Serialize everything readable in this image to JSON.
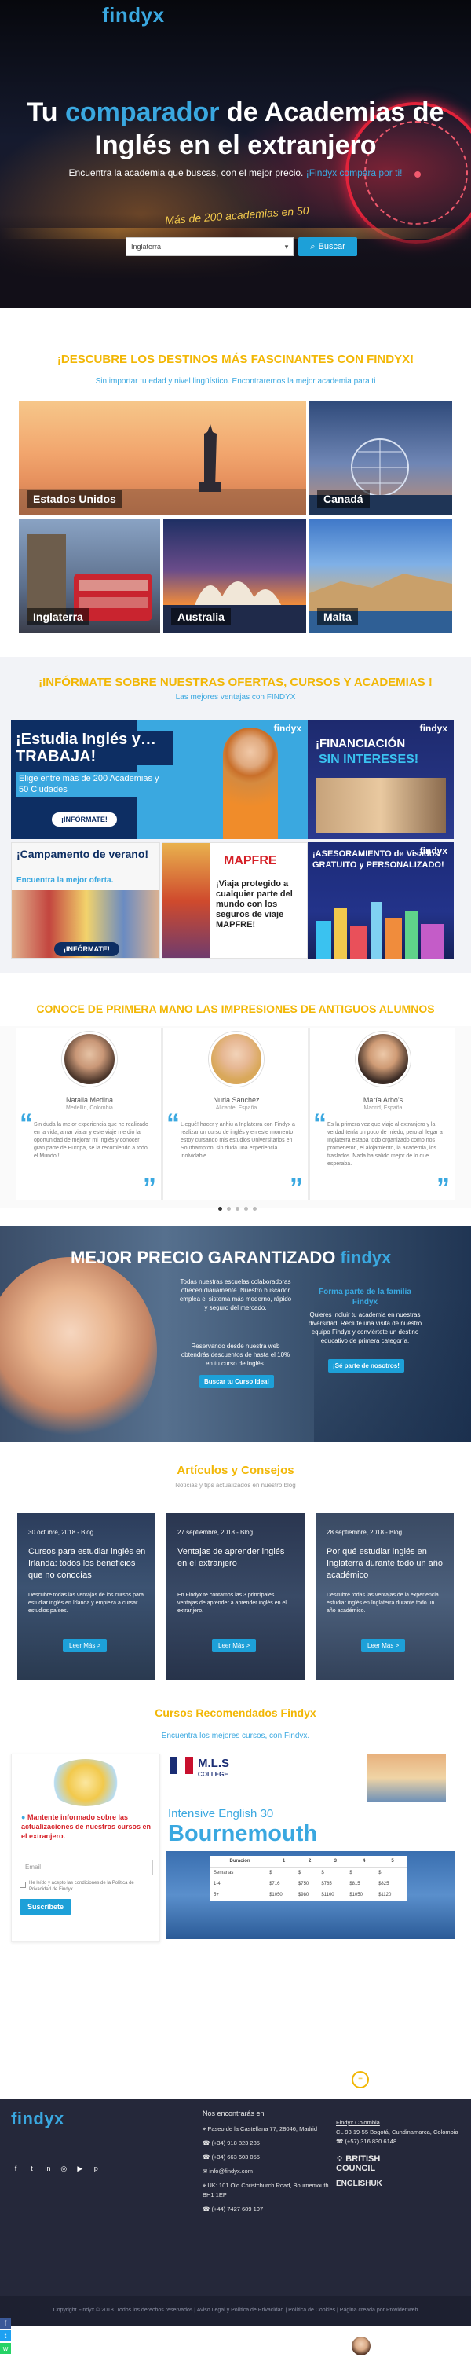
{
  "header": {
    "logo": "findyx"
  },
  "hero": {
    "title_prefix": "Tu ",
    "title_highlight": "comparador",
    "title_suffix": " de Academias de Inglés en el extranjero",
    "subtitle": "Encuentra la academia que buscas, con el mejor precio.",
    "subtitle_link": "¡Findyx compara por ti!",
    "counter": "Más de 200 academias en 50",
    "search_value": "Inglaterra",
    "search_button": "Buscar"
  },
  "destinations": {
    "title": "¡DESCUBRE LOS DESTINOS MÁS FASCINANTES CON FINDYX!",
    "subtitle": "Sin importar tu edad y nivel lingüístico. Encontraremos la mejor academia para ti",
    "items": [
      "Estados Unidos",
      "Canadá",
      "Inglaterra",
      "Australia",
      "Malta"
    ]
  },
  "offers": {
    "title": "¡INFÓRMATE SOBRE NUESTRAS OFERTAS, CURSOS Y ACADEMIAS !",
    "subtitle": "Las mejores ventajas con FINDYX",
    "brand": "findyx",
    "card1_title": "¡Estudia Inglés y… TRABAJA!",
    "card1_text": "Elige entre más de 200 Academias y 50 Ciudades",
    "card1_btn": "¡INFÓRMATE!",
    "card2_title": "¡FINANCIACIÓN",
    "card2_title2": "SIN INTERESES!",
    "card3_title": "¡Campamento de verano!",
    "card3_text": "Encuentra la mejor oferta.",
    "card3_btn": "¡INFÓRMATE!",
    "card4_text": "¡Viaja protegido a cualquier parte del mundo con los seguros de viaje MAPFRE!",
    "card4_brand": "MAPFRE",
    "card5_title": "¡ASESORAMIENTO de Visados GRATUITO y PERSONALIZADO!"
  },
  "testimonials": {
    "title": "CONOCE DE PRIMERA MANO LAS IMPRESIONES DE ANTIGUOS ALUMNOS",
    "items": [
      {
        "name": "Natalia Medina",
        "place": "Medellín, Colombia",
        "text": "Sin duda la mejor experiencia que he realizado en la vida, amar viajar y este viaje me dio la oportunidad de mejorar mi Inglés y conocer gran parte de Europa, se la recomiendo a todo el Mundo!!"
      },
      {
        "name": "Nuria Sánchez",
        "place": "Alicante, España",
        "text": "Llegué! hacer y anhiu a Inglaterra con Findyx a realizar un curso de inglés y en este momento estoy cursando mis estudios Universitarios en Southampton, sin duda una experiencia inolvidable."
      },
      {
        "name": "María Arbo's",
        "place": "Madrid, España",
        "text": "Es la primera vez que viajo al extranjero y la verdad tenía un poco de miedo, pero al llegar a Inglaterra estaba todo organizado como nos prometieron, el alojamiento, la academia, los traslados. Nada ha salido mejor de lo que esperaba."
      }
    ]
  },
  "price": {
    "title": "MEJOR PRECIO GARANTIZADO",
    "brand": "findyx",
    "text": "Todas nuestras escuelas colaboradoras ofrecen diariamente. Nuestro buscador emplea el sistema más moderno, rápido y seguro del mercado.",
    "text2": "Reservando desde nuestra web obtendrás descuentos de hasta el 10% en tu curso de inglés.",
    "btn1": "Buscar tu Curso Ideal",
    "family_title": "Forma parte de la familia Findyx",
    "family_text": "Quieres incluir tu academia en nuestras diversidad. Reclute una visita de nuestro equipo Findyx y conviértete un destino educativo de primera categoría.",
    "btn2": "¡Sé parte de nosotros!"
  },
  "articles": {
    "title": "Artículos y Consejos",
    "subtitle": "Noticias y tips actualizados en nuestro blog",
    "items": [
      {
        "date": "30 octubre, 2018 - Blog",
        "title": "Cursos para estudiar inglés en Irlanda: todos los beneficios que no conocías",
        "desc": "Descubre todas las ventajas de los cursos para estudiar inglés en Irlanda y empieza a cursar estudios países.",
        "btn": "Leer Más >"
      },
      {
        "date": "27 septiembre, 2018 - Blog",
        "title": "Ventajas de aprender inglés en el extranjero",
        "desc": "En Findyx te contamos las 3 principales ventajas de aprender a aprender inglés en el extranjero.",
        "btn": "Leer Más >"
      },
      {
        "date": "28 septiembre, 2018 - Blog",
        "title": "Por qué estudiar inglés en Inglaterra durante todo un año académico",
        "desc": "Descubre todas las ventajas de la experiencia estudiar inglés en Inglaterra durante todo un año académico.",
        "btn": "Leer Más >"
      }
    ]
  },
  "courses": {
    "title": "Cursos Recomendados Findyx",
    "subtitle": "Encuentra los mejores cursos, con Findyx.",
    "news_text": "Mantente informado sobre las actualizaciones de nuestros cursos en el extranjero.",
    "email_placeholder": "Email",
    "terms": "He leído y acepto las condiciones de la Política de Privacidad de Findyx",
    "subscribe": "Suscríbete",
    "school": "M.L.S",
    "school_sub": "COLLEGE",
    "course_title": "Intensive English 30",
    "city": "Bournemouth",
    "table_headers": [
      "Duración",
      "1",
      "2",
      "3",
      "4",
      "5"
    ],
    "table_rows": [
      [
        "Semanas",
        "$",
        "$",
        "$",
        "$",
        "$"
      ],
      [
        "1-4",
        "$716",
        "$750",
        "$785",
        "$815",
        "$825"
      ],
      [
        "5+",
        "$1050",
        "$980",
        "$1100",
        "$1050",
        "$1120"
      ]
    ]
  },
  "footer": {
    "logo": "findyx",
    "col1_title": "Nos encontrarás en",
    "address": "Paseo de la Castellana 77, 28046, Madrid",
    "phone1": "(+34) 918 823 285",
    "phone2": "(+34) 663 603 055",
    "email": "info@findyx.com",
    "address2": "UK: 101 Old Christchurch Road, Bournemouth BH1 1EP",
    "phone3": "(+44) 7427 689 107",
    "col2_title": "Findyx Colombia",
    "col2_addr": "CL 93 19-55 Bogotá, Cundinamarca, Colombia",
    "col2_phone": "(+57) 316 830 6148",
    "partner1": "BRITISH COUNCIL",
    "partner2": "ENGLISHUK",
    "copyright": "Copyright Findyx © 2018. Todos los derechos reservados | Aviso Legal y Política de Privacidad | Política de Cookies | Página creada por Providenweb"
  },
  "colors": {
    "accent": "#3aa8e0",
    "yellow": "#f2b705",
    "footer": "#25283a"
  }
}
